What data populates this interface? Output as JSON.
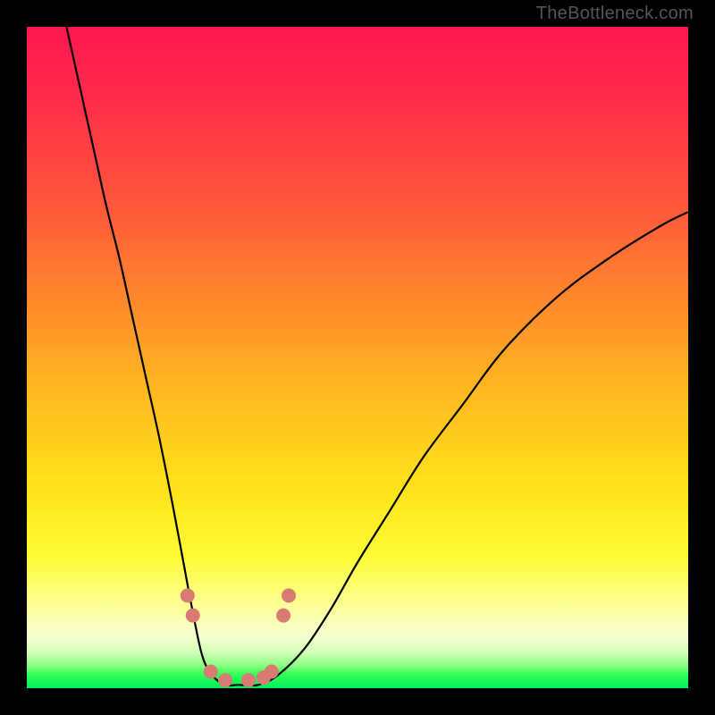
{
  "watermark": "TheBottleneck.com",
  "colors": {
    "frame": "#000000",
    "gradient_top": "#ff1650",
    "gradient_mid": "#ffe31a",
    "gradient_bottom": "#00ef5c",
    "curve": "#000000",
    "markers": "#d77b73"
  },
  "chart_data": {
    "type": "line",
    "title": "",
    "xlabel": "",
    "ylabel": "",
    "xlim": [
      0,
      100
    ],
    "ylim": [
      0,
      100
    ],
    "grid": false,
    "x": [
      6,
      8,
      10,
      12,
      14,
      16,
      18,
      20,
      22,
      23.5,
      25,
      26.5,
      28,
      30,
      32,
      35,
      38,
      42,
      46,
      50,
      55,
      60,
      66,
      72,
      80,
      88,
      96,
      100
    ],
    "y": [
      100,
      91,
      82,
      73,
      65,
      56,
      47,
      38,
      28,
      20,
      12,
      5,
      2,
      0.5,
      0.5,
      0.5,
      2,
      6,
      12,
      19,
      27,
      35,
      43,
      51,
      59,
      65,
      70,
      72
    ],
    "series": [
      {
        "name": "curve",
        "x": [
          6,
          8,
          10,
          12,
          14,
          16,
          18,
          20,
          22,
          23.5,
          25,
          26.5,
          28,
          30,
          32,
          35,
          38,
          42,
          46,
          50,
          55,
          60,
          66,
          72,
          80,
          88,
          96,
          100
        ],
        "y": [
          100,
          91,
          82,
          73,
          65,
          56,
          47,
          38,
          28,
          20,
          12,
          5,
          2,
          0.5,
          0.5,
          0.5,
          2,
          6,
          12,
          19,
          27,
          35,
          43,
          51,
          59,
          65,
          70,
          72
        ]
      }
    ],
    "markers": [
      {
        "x": 24.3,
        "y": 14
      },
      {
        "x": 25.1,
        "y": 11
      },
      {
        "x": 27.8,
        "y": 2.5
      },
      {
        "x": 30.0,
        "y": 1.2
      },
      {
        "x": 33.5,
        "y": 1.2
      },
      {
        "x": 35.8,
        "y": 1.6
      },
      {
        "x": 37.0,
        "y": 2.5
      },
      {
        "x": 38.8,
        "y": 11
      },
      {
        "x": 39.6,
        "y": 14
      }
    ]
  }
}
